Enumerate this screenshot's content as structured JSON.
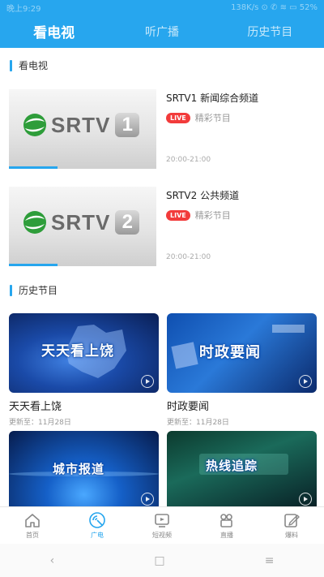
{
  "status_bar": {
    "carrier": "晚上9:29",
    "right": "138K/s ⊙ ✆ ≋ ▭ 52%"
  },
  "tabs": [
    {
      "label": "看电视",
      "active": true
    },
    {
      "label": "听广播",
      "active": false
    },
    {
      "label": "历史节目",
      "active": false
    }
  ],
  "sections": {
    "tv": "看电视",
    "history": "历史节目"
  },
  "channels": [
    {
      "title": "SRTV1 新闻综合频道",
      "live": "LIVE",
      "now": "精彩节目",
      "time": "20:00-21:00",
      "logo_text": "SRTV",
      "logo_num": "1",
      "progress": 0.33
    },
    {
      "title": "SRTV2 公共频道",
      "live": "LIVE",
      "now": "精彩节目",
      "time": "20:00-21:00",
      "logo_text": "SRTV",
      "logo_num": "2",
      "progress": 0.33
    }
  ],
  "history": [
    {
      "title": "天天看上饶",
      "date": "更新至：11月28日",
      "caption": "天天看上饶"
    },
    {
      "title": "时政要闻",
      "date": "更新至：11月28日",
      "caption": "时政要闻"
    },
    {
      "title": "",
      "date": "",
      "caption": "城市报道"
    },
    {
      "title": "",
      "date": "",
      "caption": "热线追踪"
    }
  ],
  "bottom_nav": [
    {
      "label": "首页",
      "icon": "home-icon",
      "active": false
    },
    {
      "label": "广电",
      "icon": "broadcast-icon",
      "active": true
    },
    {
      "label": "短视频",
      "icon": "short-video-icon",
      "active": false
    },
    {
      "label": "直播",
      "icon": "live-camera-icon",
      "active": false
    },
    {
      "label": "爆料",
      "icon": "edit-report-icon",
      "active": false
    }
  ],
  "system_nav": {
    "back": "‹",
    "home": "□",
    "menu": "≡"
  },
  "colors": {
    "accent": "#27a6ee",
    "live": "#f23b3b"
  }
}
